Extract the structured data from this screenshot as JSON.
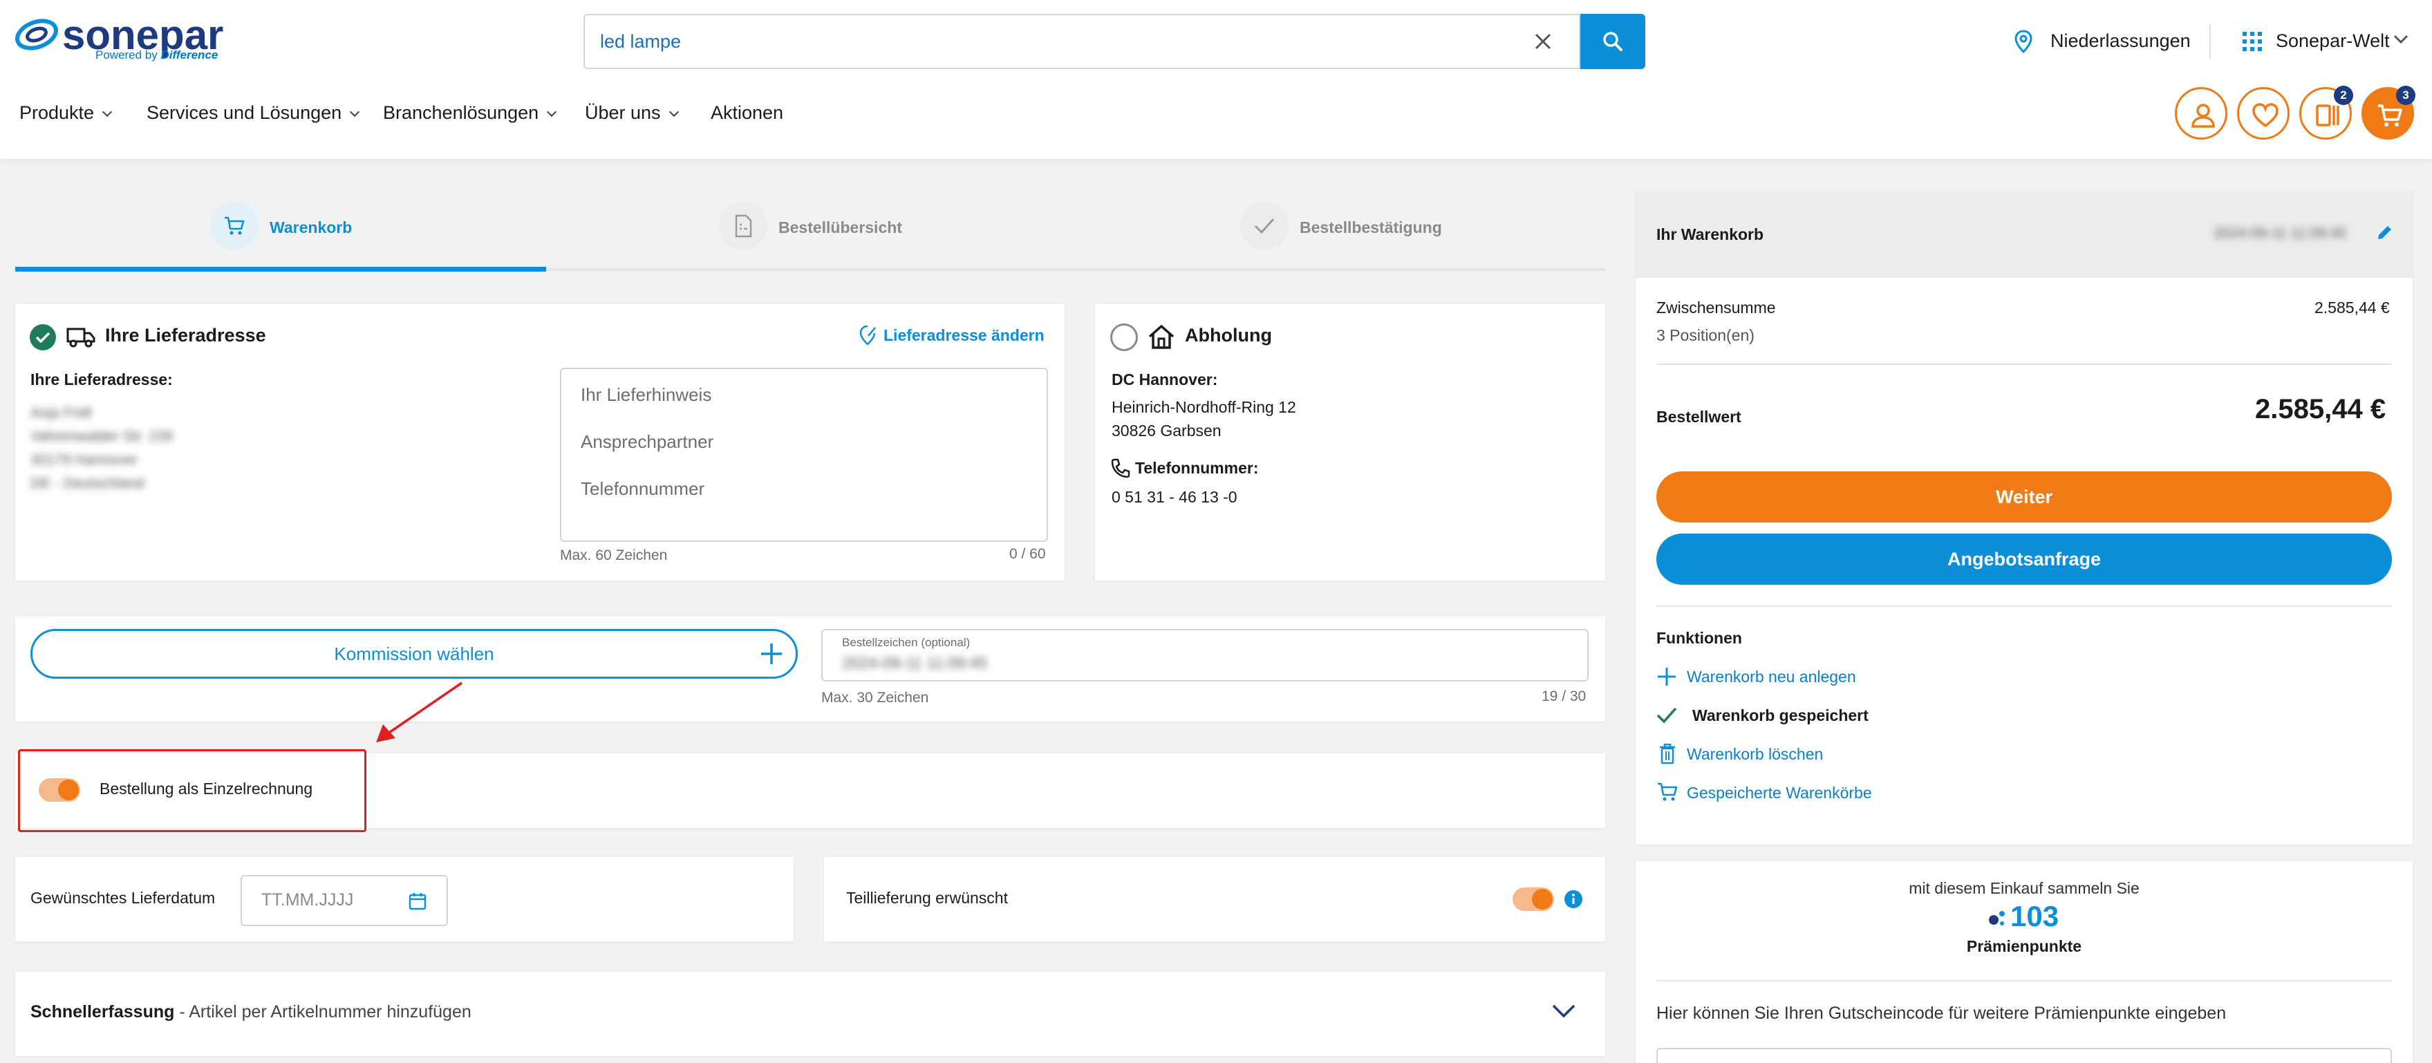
{
  "header": {
    "logo_text": "sonepar",
    "logo_tagline_prefix": "Powered by",
    "logo_tagline_brand": "Difference",
    "search_value": "led lampe",
    "locations_label": "Niederlassungen",
    "world_label": "Sonepar-Welt",
    "compare_badge": "2",
    "cart_badge": "3",
    "colors": {
      "brand_blue": "#0a8fd8",
      "brand_orange": "#f07a16",
      "navy": "#1d3b80"
    }
  },
  "nav": {
    "items": [
      {
        "label": "Produkte",
        "has_dropdown": true
      },
      {
        "label": "Services und Lösungen",
        "has_dropdown": true
      },
      {
        "label": "Branchenlösungen",
        "has_dropdown": true
      },
      {
        "label": "Über uns",
        "has_dropdown": true
      },
      {
        "label": "Aktionen",
        "has_dropdown": false
      }
    ]
  },
  "steps": [
    {
      "label": "Warenkorb",
      "icon": "cart-icon",
      "active": true
    },
    {
      "label": "Bestellübersicht",
      "icon": "document-icon",
      "active": false
    },
    {
      "label": "Bestellbestätigung",
      "icon": "check-icon",
      "active": false
    }
  ],
  "delivery": {
    "title": "Ihre Lieferadresse",
    "change_link": "Lieferadresse ändern",
    "address_label": "Ihre Lieferadresse:",
    "address_lines": [
      "Anja Fridl",
      "Vahrenwalder Str. 239",
      "30179 Hannover",
      "DE - Deutschland"
    ],
    "note_placeholders": [
      "Ihr Lieferhinweis",
      "Ansprechpartner",
      "Telefonnummer"
    ],
    "note_max": "Max. 60 Zeichen",
    "note_count": "0 / 60"
  },
  "pickup": {
    "title": "Abholung",
    "branch": "DC Hannover:",
    "street": "Heinrich-Nordhoff-Ring 12",
    "city": "30826 Garbsen",
    "phone_label": "Telefonnummer:",
    "phone": "0 51 31 - 46 13 -0"
  },
  "commission": {
    "button_label": "Kommission wählen",
    "order_ref_label": "Bestellzeichen (optional)",
    "order_ref_value": "2024-09-11 11:09:45",
    "order_ref_max": "Max. 30 Zeichen",
    "order_ref_count": "19 / 30"
  },
  "single_invoice": {
    "label": "Bestellung als Einzelrechnung",
    "enabled": true
  },
  "delivery_date": {
    "label": "Gewünschtes Lieferdatum",
    "placeholder": "TT.MM.JJJJ"
  },
  "partial_delivery": {
    "label": "Teillieferung erwünscht",
    "enabled": true
  },
  "quick_entry": {
    "title": "Schnellerfassung",
    "subtitle": " - Artikel per Artikelnummer hinzufügen"
  },
  "summary": {
    "title": "Ihr Warenkorb",
    "cart_name": "2024-09-11 11:09:45",
    "subtotal_label": "Zwischensumme",
    "subtotal_value": "2.585,44 €",
    "positions": "3 Position(en)",
    "order_value_label": "Bestellwert",
    "order_value": "2.585,44 €",
    "continue_button": "Weiter",
    "quote_button": "Angebotsanfrage",
    "functions_title": "Funktionen",
    "functions": [
      {
        "label": "Warenkorb neu anlegen",
        "icon": "plus-icon",
        "link": true
      },
      {
        "label": "Warenkorb gespeichert",
        "icon": "check-icon",
        "link": false
      },
      {
        "label": "Warenkorb löschen",
        "icon": "trash-icon",
        "link": true
      },
      {
        "label": "Gespeicherte Warenkörbe",
        "icon": "cart-icon",
        "link": true
      }
    ]
  },
  "rewards": {
    "intro": "mit diesem Einkauf sammeln Sie",
    "points": "103",
    "points_label": "Prämienpunkte",
    "voucher_text": "Hier können Sie Ihren Gutscheincode für weitere Prämienpunkte eingeben"
  }
}
